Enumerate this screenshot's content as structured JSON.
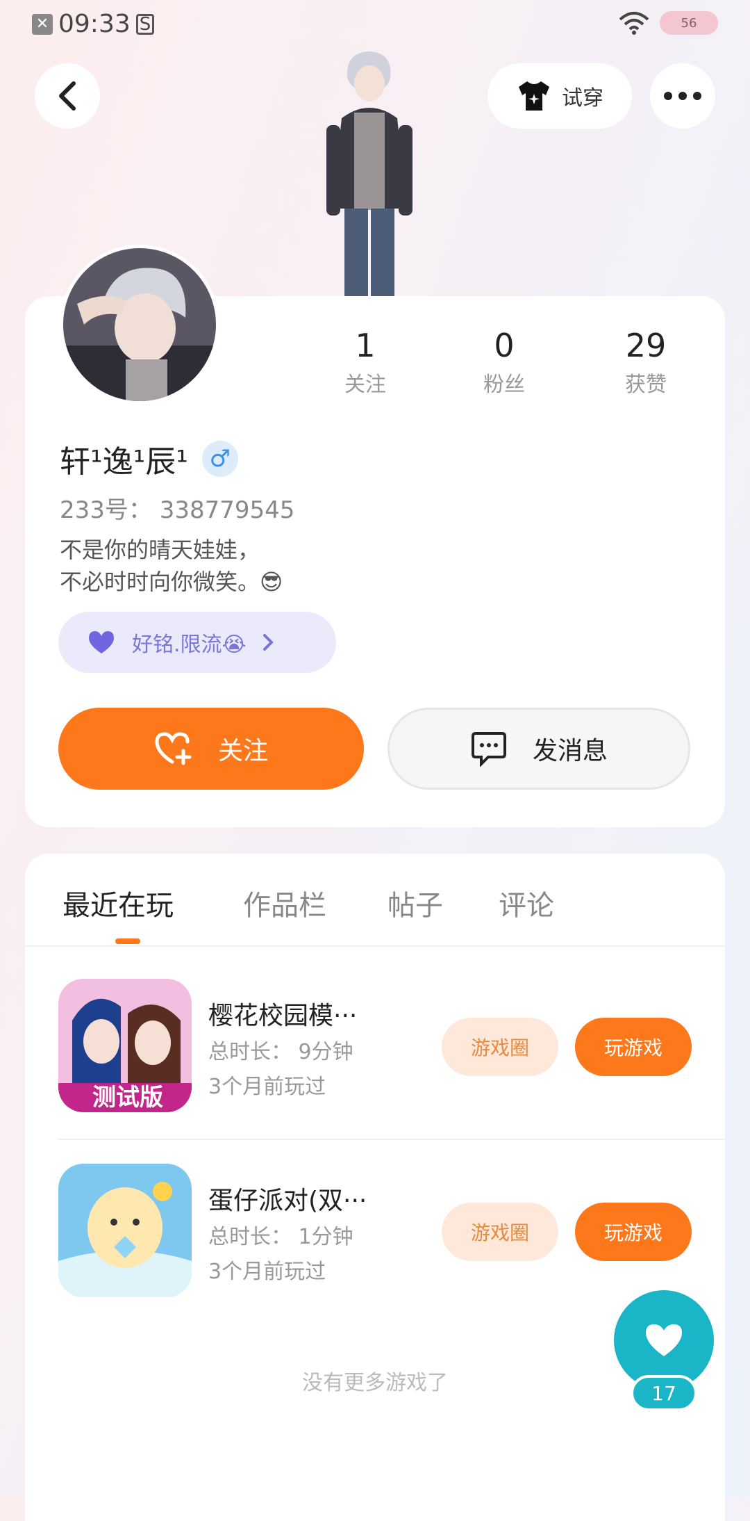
{
  "status_bar": {
    "time": "09:33",
    "battery": "56"
  },
  "header": {
    "try_on_label": "试穿"
  },
  "profile": {
    "stats": [
      {
        "value": "1",
        "label": "关注"
      },
      {
        "value": "0",
        "label": "粉丝"
      },
      {
        "value": "29",
        "label": "获赞"
      }
    ],
    "name": "轩¹逸¹辰¹",
    "gender_symbol": "♂",
    "uid": "233号： 338779545",
    "bio_line1": "不是你的晴天娃娃，",
    "bio_line2": "不必时时向你微笑。😎",
    "tag": "好铭.限流😭",
    "follow_label": "关注",
    "message_label": "发消息"
  },
  "tabs": [
    {
      "label": "最近在玩"
    },
    {
      "label": "作品栏"
    },
    {
      "label": "帖子"
    },
    {
      "label": "评论"
    }
  ],
  "games": [
    {
      "title": "樱花校园模···",
      "duration": "总时长： 9分钟",
      "last_played": "3个月前玩过",
      "circle_label": "游戏圈",
      "play_label": "玩游戏",
      "icon_badge": "测试版"
    },
    {
      "title": "蛋仔派对(双···",
      "duration": "总时长： 1分钟",
      "last_played": "3个月前玩过",
      "circle_label": "游戏圈",
      "play_label": "玩游戏"
    }
  ],
  "no_more_text": "没有更多游戏了",
  "like": {
    "count": "17"
  },
  "colors": {
    "accent": "#fd781a",
    "like": "#1ab5c6",
    "tag_text": "#7a75d9"
  }
}
